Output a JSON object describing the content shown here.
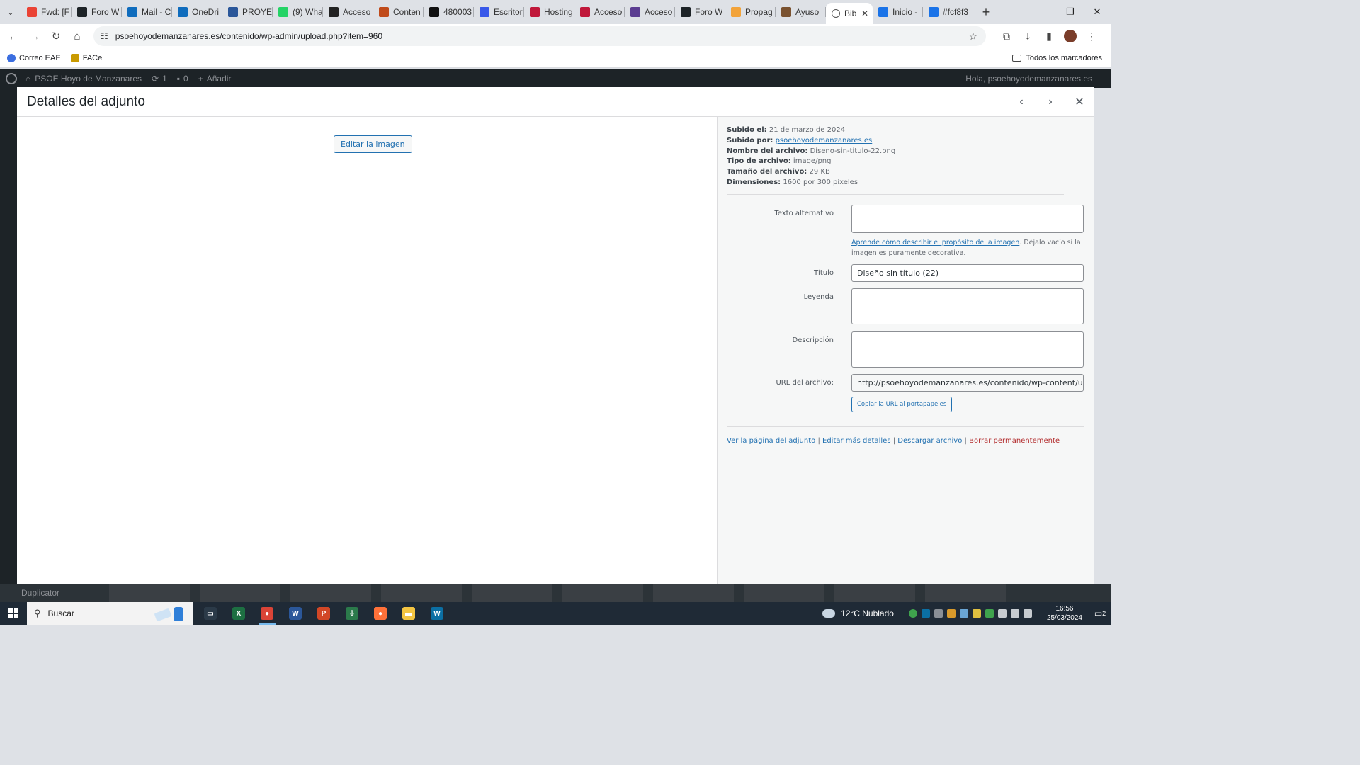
{
  "browser": {
    "tabs": [
      {
        "label": "Fwd: [F",
        "icon": "gmail-icon",
        "color": "#ea4335"
      },
      {
        "label": "Foro W",
        "icon": "w-icon",
        "color": "#1d2327"
      },
      {
        "label": "Mail - C",
        "icon": "outlook-icon",
        "color": "#0f6cbd"
      },
      {
        "label": "OneDri",
        "icon": "outlook-icon",
        "color": "#0f6cbd"
      },
      {
        "label": "PROYEC",
        "icon": "word-icon",
        "color": "#2b579a"
      },
      {
        "label": "(9) Wha",
        "icon": "whatsapp-icon",
        "color": "#25d366"
      },
      {
        "label": "Acceso",
        "icon": "obs-icon",
        "color": "#222222"
      },
      {
        "label": "Conten",
        "icon": "chart-icon",
        "color": "#c04b1b"
      },
      {
        "label": "480003",
        "icon": "bb-icon",
        "color": "#111111"
      },
      {
        "label": "Escritor",
        "icon": "wordpress-icon",
        "color": "#3858e9"
      },
      {
        "label": "Hosting",
        "icon": "w-icon",
        "color": "#c0183a"
      },
      {
        "label": "Acceso",
        "icon": "w-icon",
        "color": "#c0183a"
      },
      {
        "label": "Acceso",
        "icon": "w-icon",
        "color": "#5b3d91"
      },
      {
        "label": "Foro W",
        "icon": "w-icon",
        "color": "#1d2327"
      },
      {
        "label": "Propag",
        "icon": "canva-icon",
        "color": "#f2a33a"
      },
      {
        "label": "Ayuso",
        "icon": "photo-icon",
        "color": "#7a5230"
      }
    ],
    "active_tab": {
      "label": "Bib",
      "icon": "globe-icon"
    },
    "tabs_after": [
      {
        "label": "Inicio -",
        "icon": "chrome-icon",
        "color": "#1a73e8"
      },
      {
        "label": "#fcf8f3",
        "icon": "chrome-icon",
        "color": "#1a73e8"
      }
    ],
    "url": "psoehoyodemanzanares.es/contenido/wp-admin/upload.php?item=960",
    "bookmarks": [
      {
        "label": "Correo EAE",
        "color": "#3b6ee0"
      },
      {
        "label": "FACe",
        "color": "#c99a00"
      }
    ],
    "all_bookmarks": "Todos los marcadores"
  },
  "wp_admin_bar": {
    "site": "PSOE Hoyo de Manzanares",
    "updates": "1",
    "comments": "0",
    "add_new": "Añadir",
    "greeting": "Hola, psoehoyodemanzanares.es"
  },
  "wp_bottom": {
    "plugin": "Duplicator"
  },
  "modal": {
    "title": "Detalles del adjunto",
    "edit_image": "Editar la imagen",
    "meta": {
      "uploaded_on_label": "Subido el:",
      "uploaded_on": "21 de marzo de 2024",
      "uploaded_by_label": "Subido por:",
      "uploaded_by": "psoehoyodemanzanares.es",
      "file_name_label": "Nombre del archivo:",
      "file_name": "Diseno-sin-titulo-22.png",
      "file_type_label": "Tipo de archivo:",
      "file_type": "image/png",
      "file_size_label": "Tamaño del archivo:",
      "file_size": "29 KB",
      "dimensions_label": "Dimensiones:",
      "dimensions": "1600 por 300 píxeles"
    },
    "fields": {
      "alt_label": "Texto alternativo",
      "alt_value": "",
      "alt_help_link": "Aprende cómo describir el propósito de la imagen",
      "alt_help_text": ". Déjalo vacío si la imagen es puramente decorativa.",
      "title_label": "Título",
      "title_value": "Diseño sin título (22)",
      "caption_label": "Leyenda",
      "caption_value": "",
      "description_label": "Descripción",
      "description_value": "",
      "url_label": "URL del archivo:",
      "url_value": "http://psoehoyodemanzanares.es/contenido/wp-content/uplo",
      "copy_url": "Copiar la URL al portapapeles"
    },
    "actions": {
      "view": "Ver la página del adjunto",
      "edit": "Editar más detalles",
      "download": "Descargar archivo",
      "delete": "Borrar permanentemente",
      "separator": "|"
    }
  },
  "taskbar": {
    "search_placeholder": "Buscar",
    "apps": [
      {
        "icon": "task-view-icon",
        "color": "#2b3a48",
        "glyph": "▭"
      },
      {
        "icon": "excel-icon",
        "color": "#1d6f42",
        "glyph": "X"
      },
      {
        "icon": "chrome-icon",
        "color": "#db4437",
        "glyph": "●"
      },
      {
        "icon": "word-icon",
        "color": "#2b579a",
        "glyph": "W"
      },
      {
        "icon": "powerpoint-icon",
        "color": "#d24726",
        "glyph": "P"
      },
      {
        "icon": "download-app-icon",
        "color": "#2b7a4b",
        "glyph": "⇩"
      },
      {
        "icon": "firefox-icon",
        "color": "#ff7139",
        "glyph": "●"
      },
      {
        "icon": "file-explorer-icon",
        "color": "#f4c542",
        "glyph": "▬"
      },
      {
        "icon": "w-app-icon",
        "color": "#0b6fa4",
        "glyph": "W"
      }
    ],
    "weather": "12°C  Nublado",
    "time": "16:56",
    "date": "25/03/2024",
    "notifications": "2"
  }
}
